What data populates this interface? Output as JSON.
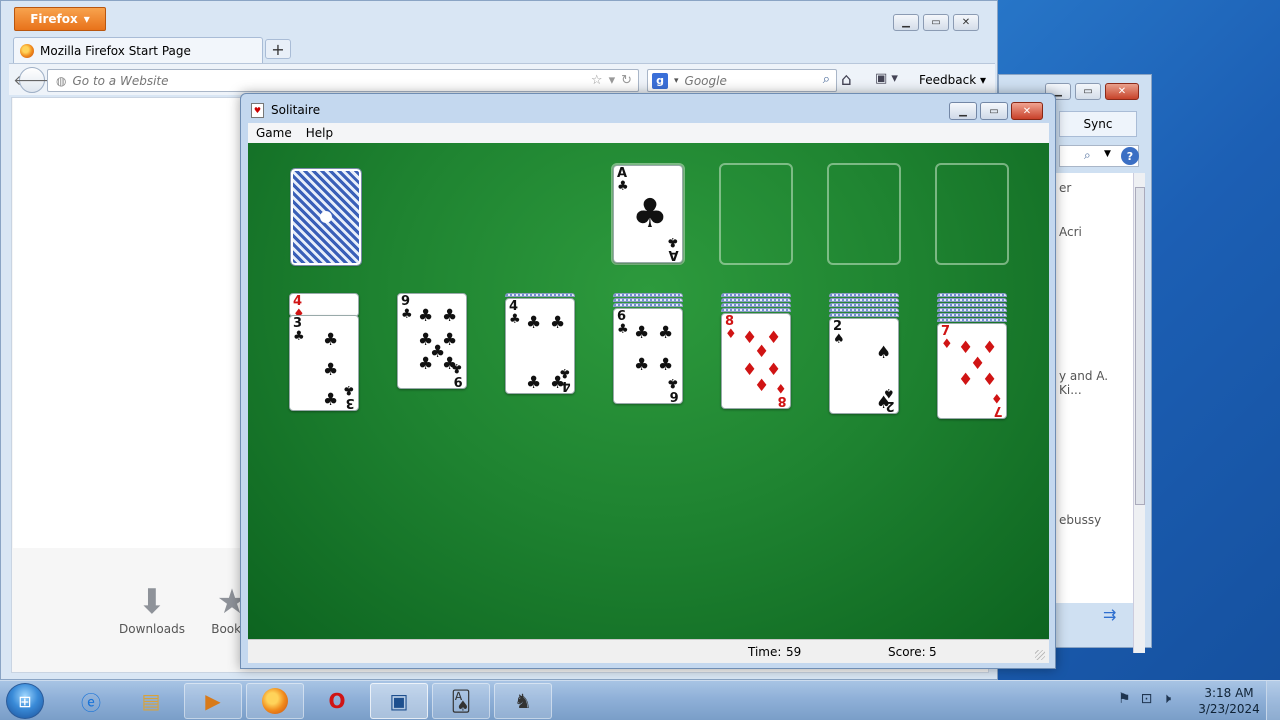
{
  "firefox": {
    "menu_button": "Firefox",
    "tab_title": "Mozilla Firefox Start Page",
    "url_placeholder": "Go to a Website",
    "search_placeholder": "Google",
    "feedback_label": "Feedback",
    "shortcuts": [
      {
        "label": "Downloads",
        "icon": "download-icon"
      },
      {
        "label": "Bookm",
        "icon": "bookmark-icon"
      }
    ]
  },
  "background_window": {
    "tab_label": "Sync",
    "list_items": [
      "er",
      "Acri",
      "y and A. Ki...",
      "ebussy"
    ]
  },
  "solitaire": {
    "title": "Solitaire",
    "menus": [
      "Game",
      "Help"
    ],
    "status": {
      "time_label": "Time:",
      "time_value": "59",
      "score_label": "Score:",
      "score_value": "5"
    },
    "foundation": [
      {
        "rank": "A",
        "suit": "♣",
        "color": "black"
      },
      null,
      null,
      null
    ],
    "tableau": [
      {
        "hidden": 0,
        "cards": [
          {
            "rank": "4",
            "suit": "♦",
            "color": "red"
          },
          {
            "rank": "3",
            "suit": "♣",
            "color": "black"
          }
        ]
      },
      {
        "hidden": 0,
        "cards": [
          {
            "rank": "9",
            "suit": "♣",
            "color": "black"
          }
        ]
      },
      {
        "hidden": 1,
        "cards": [
          {
            "rank": "4",
            "suit": "♣",
            "color": "black"
          }
        ]
      },
      {
        "hidden": 3,
        "cards": [
          {
            "rank": "6",
            "suit": "♣",
            "color": "black"
          }
        ]
      },
      {
        "hidden": 4,
        "cards": [
          {
            "rank": "8",
            "suit": "♦",
            "color": "red"
          }
        ]
      },
      {
        "hidden": 5,
        "cards": [
          {
            "rank": "2",
            "suit": "♠",
            "color": "black"
          }
        ]
      },
      {
        "hidden": 6,
        "cards": [
          {
            "rank": "7",
            "suit": "♦",
            "color": "red"
          }
        ]
      }
    ]
  },
  "taskbar": {
    "clock_time": "3:18 AM",
    "clock_date": "3/23/2024",
    "apps": [
      "internet-explorer-icon",
      "file-explorer-icon",
      "media-player-icon",
      "firefox-icon",
      "opera-icon",
      "virtualbox-icon",
      "solitaire-icon",
      "chess-icon"
    ]
  },
  "colors": {
    "felt": "#1f8431",
    "red_suit": "#d01414",
    "firefox_orange": "#e8721a"
  }
}
